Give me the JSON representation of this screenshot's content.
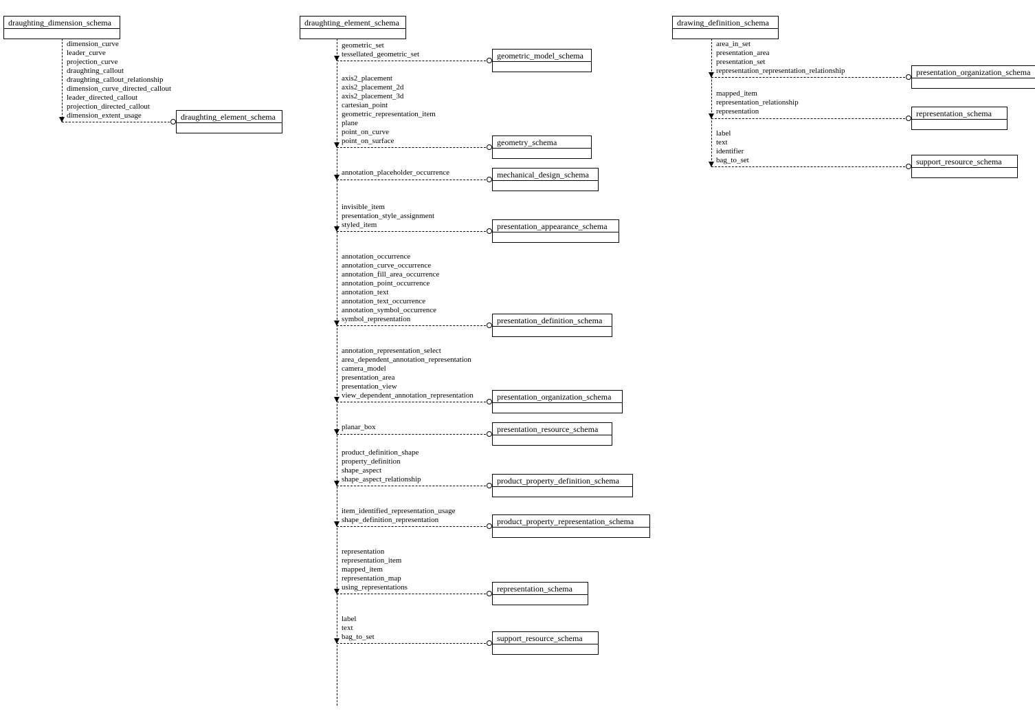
{
  "source_schemas": {
    "dimension": "draughting_dimension_schema",
    "element": "draughting_element_schema",
    "drawing": "drawing_definition_schema"
  },
  "targets": {
    "col1": [
      "draughting_element_schema"
    ],
    "col2": [
      "geometric_model_schema",
      "geometry_schema",
      "mechanical_design_schema",
      "presentation_appearance_schema",
      "presentation_definition_schema",
      "presentation_organization_schema",
      "presentation_resource_schema",
      "product_property_definition_schema",
      "product_property_representation_schema",
      "representation_schema",
      "support_resource_schema"
    ],
    "col3": [
      "presentation_organization_schema",
      "representation_schema",
      "support_resource_schema"
    ]
  },
  "items": {
    "dim_to_elem": [
      "dimension_curve",
      "leader_curve",
      "projection_curve",
      "draughting_callout",
      "draughting_callout_relationship",
      "dimension_curve_directed_callout",
      "leader_directed_callout",
      "projection_directed_callout",
      "dimension_extent_usage"
    ],
    "elem": {
      "geometric_model": [
        "geometric_set",
        "tessellated_geometric_set"
      ],
      "geometry": [
        "axis2_placement",
        "axis2_placement_2d",
        "axis2_placement_3d",
        "cartesian_point",
        "geometric_representation_item",
        "plane",
        "point_on_curve",
        "point_on_surface"
      ],
      "mechanical": [
        "annotation_placeholder_occurrence"
      ],
      "appearance": [
        "invisible_item",
        "presentation_style_assignment",
        "styled_item"
      ],
      "definition": [
        "annotation_occurrence",
        "annotation_curve_occurrence",
        "annotation_fill_area_occurrence",
        "annotation_point_occurrence",
        "annotation_text",
        "annotation_text_occurrence",
        "annotation_symbol_occurrence",
        "symbol_representation"
      ],
      "organization": [
        "annotation_representation_select",
        "area_dependent_annotation_representation",
        "camera_model",
        "presentation_area",
        "presentation_view",
        "view_dependent_annotation_representation"
      ],
      "resource": [
        "planar_box"
      ],
      "prop_def": [
        "product_definition_shape",
        "property_definition",
        "shape_aspect",
        "shape_aspect_relationship"
      ],
      "prop_rep": [
        "item_identified_representation_usage",
        "shape_definition_representation"
      ],
      "representation": [
        "representation",
        "representation_item",
        "mapped_item",
        "representation_map",
        "using_representations"
      ],
      "support": [
        "label",
        "text",
        "bag_to_set"
      ]
    },
    "drawing": {
      "pres_org": [
        "area_in_set",
        "presentation_area",
        "presentation_set",
        "representation_representation_relationship"
      ],
      "rep": [
        "mapped_item",
        "representation_relationship",
        "representation"
      ],
      "support": [
        "label",
        "text",
        "identifier",
        "bag_to_set"
      ]
    }
  }
}
